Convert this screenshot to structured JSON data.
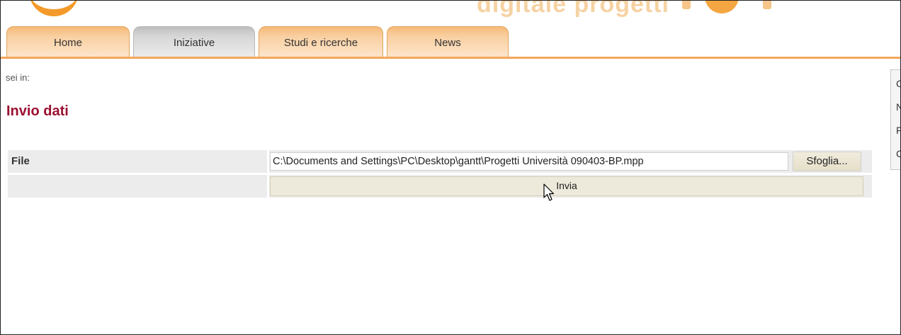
{
  "banner": {
    "text": "digitale  progetti"
  },
  "tabs": [
    {
      "label": "Home",
      "active": false
    },
    {
      "label": "Iniziative",
      "active": true
    },
    {
      "label": "Studi e ricerche",
      "active": false
    },
    {
      "label": "News",
      "active": false
    }
  ],
  "breadcrumb": {
    "label": "sei in:"
  },
  "page": {
    "title": "Invio dati"
  },
  "form": {
    "file_label": "File",
    "file_value": "C:\\Documents and Settings\\PC\\Desktop\\gantt\\Progetti Università 090403-BP.mpp",
    "browse_label": "Sfoglia...",
    "submit_label": "Invia"
  },
  "side_panel": {
    "items": [
      "C",
      "N",
      "F",
      "C"
    ]
  },
  "colors": {
    "accent": "#f39a2a",
    "title": "#9b1030",
    "active_tab": "#d6d6d6"
  }
}
